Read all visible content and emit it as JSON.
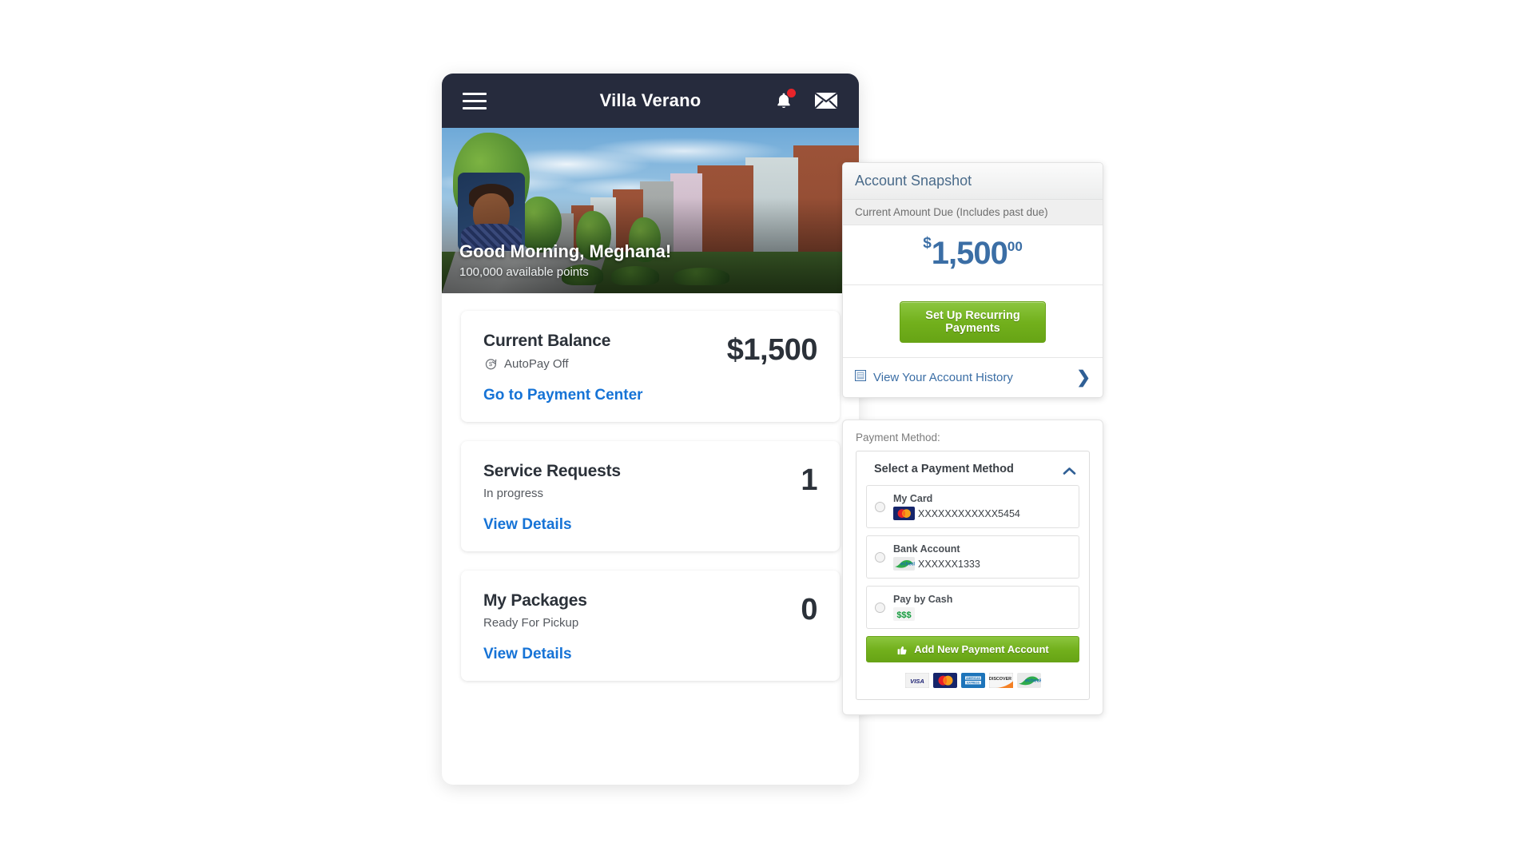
{
  "phone": {
    "header": {
      "title": "Villa Verano",
      "menu_icon": "hamburger-icon",
      "bell_icon": "notification-bell-icon",
      "mail_icon": "envelope-icon"
    },
    "hero": {
      "greeting": "Good Morning, Meghana!",
      "points": "100,000 available points",
      "avatar_alt": "resident-avatar"
    },
    "cards": [
      {
        "title": "Current Balance",
        "subtitle": "AutoPay Off",
        "sub_icon": "autopay-off-icon",
        "value": "$1,500",
        "link": "Go to Payment Center"
      },
      {
        "title": "Service Requests",
        "subtitle": "In progress",
        "value": "1",
        "link": "View Details"
      },
      {
        "title": "My Packages",
        "subtitle": "Ready For Pickup",
        "value": "0",
        "link": "View Details"
      }
    ]
  },
  "snapshot": {
    "title": "Account Snapshot",
    "due_label": "Current Amount Due (Includes past due)",
    "amount": {
      "currency": "$",
      "main": "1,500",
      "cents": "00"
    },
    "recurring_button": "Set Up Recurring Payments",
    "history_link": "View Your Account History",
    "history_icon": "document-icon",
    "chevron_icon": "chevron-right-icon"
  },
  "payment": {
    "label": "Payment Method:",
    "select_title": "Select a Payment Method",
    "collapse_icon": "chevron-up-icon",
    "methods": [
      {
        "name": "My Card",
        "number": "XXXXXXXXXXXX5454",
        "logo": "mastercard-logo",
        "selected": false
      },
      {
        "name": "Bank Account",
        "number": "XXXXXX1333",
        "logo": "echeck-logo",
        "selected": false
      },
      {
        "name": "Pay by Cash",
        "number": "",
        "logo": "cash-dollars-logo",
        "selected": false
      }
    ],
    "add_button": "Add New Payment Account",
    "add_icon": "thumbs-up-icon",
    "brands": [
      "visa-logo",
      "mastercard-logo",
      "amex-logo",
      "discover-logo",
      "echeck-logo"
    ]
  },
  "colors": {
    "header_bg": "#262b3d",
    "accent_blue": "#1673d6",
    "snapshot_blue": "#3b6ea5",
    "green_button": "#72b01c",
    "bell_dot": "#e8242a"
  }
}
